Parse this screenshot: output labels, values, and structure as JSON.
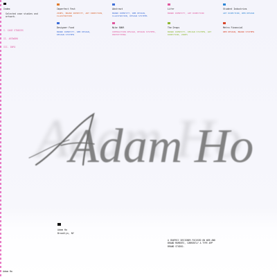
{
  "index": {
    "label": "Index",
    "description": "Selected case studies and artwork."
  },
  "categories": [
    "I. CASE STUDIES",
    "II. ARTWORK",
    "III. INFO"
  ],
  "projects": [
    {
      "name": "Imperfect Fest",
      "tags": "ZINES, BRAND IDENTITY, ART DIRECTION, ILLUSTRATION",
      "color": "#e07a2c",
      "tagColor": "#d9622b"
    },
    {
      "name": "Abstract",
      "tags": "BRAND IDENTITY, WEB DESIGN, ILLUSTRATION, DESIGN SYSTEMS",
      "color": "#3f6fd8",
      "tagColor": "#3f6fd8"
    },
    {
      "name": "Lifer",
      "tags": "BRAND IDENTITY, ART DIRECTION",
      "color": "#e0569d",
      "tagColor": "#e0569d"
    },
    {
      "name": "Student Industries",
      "tags": "ART DIRECTION, WEB DESIGN",
      "color": "#2f86d6",
      "tagColor": "#2f86d6"
    },
    {
      "name": "Designer Fund",
      "tags": "BRAND IDENTITY, WEB DESIGN, DESIGN SYSTEMS",
      "color": "#3f6fd8",
      "tagColor": "#3f6fd8"
    },
    {
      "name": "Nike SNKR",
      "tags": "INTERACTION DESIGN, DESIGN SYSTEMS, PROTOTYPING",
      "color": "#e0569d",
      "tagColor": "#e0569d"
    },
    {
      "name": "The Drops",
      "tags": "BRAND IDENTITY, DESIGN SYSTEMS, ART DIRECTION, ZINES",
      "color": "#8fb833",
      "tagColor": "#8fb833"
    },
    {
      "name": "Metro Financial",
      "tags": "WEB DESIGN, BRAND SYSTEMS",
      "color": "#d9462b",
      "tagColor": "#d9462b"
    }
  ],
  "signature": "Adam Ho",
  "footer": {
    "name": "Adam Ho",
    "location": "Brooklyn, NY",
    "bio": "A graphic designer focused on web and brand moments, currently a type app brand studio."
  },
  "corner_name": "Adam Ho"
}
